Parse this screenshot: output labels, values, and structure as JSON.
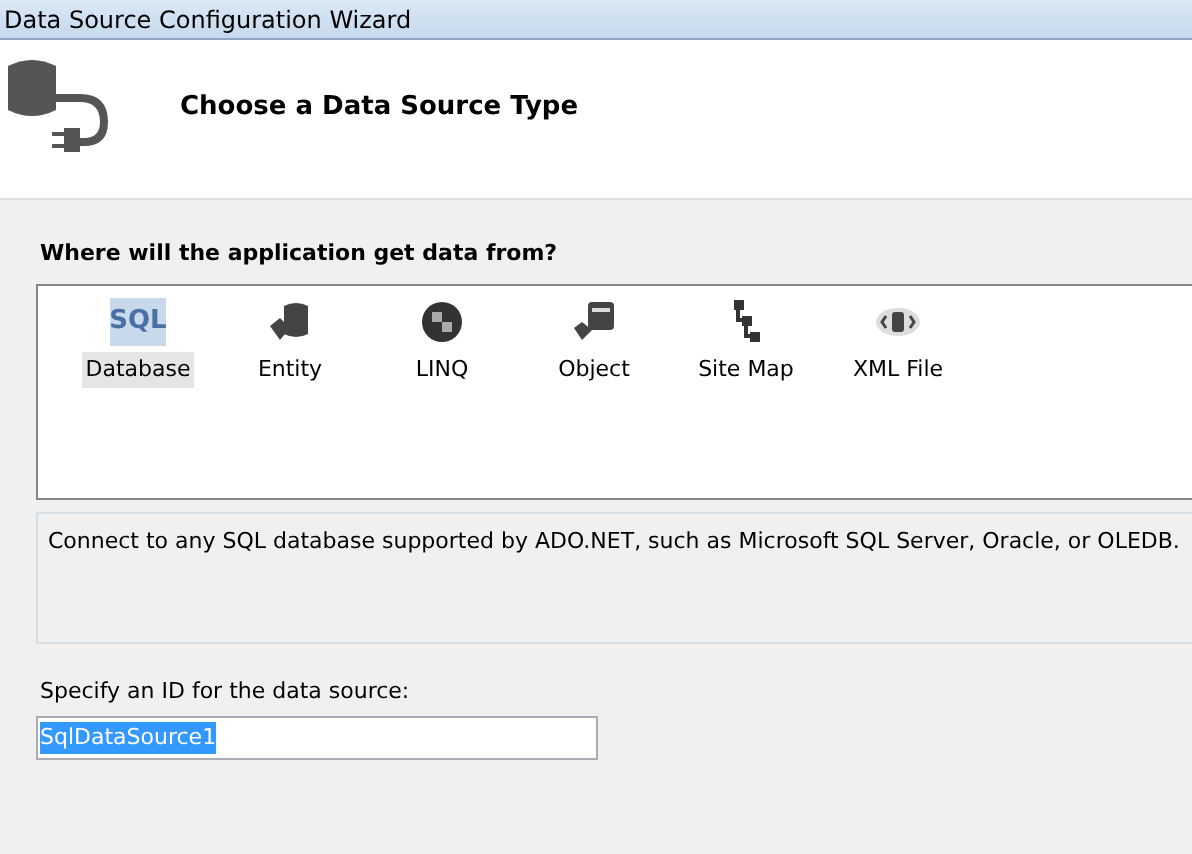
{
  "window": {
    "title": "Data Source Configuration Wizard"
  },
  "header": {
    "title": "Choose a Data Source Type"
  },
  "source_list": {
    "label": "Where will the application get data from?",
    "items": [
      {
        "label": "Database",
        "kind": "sql",
        "icon_text": "SQL",
        "selected": true
      },
      {
        "label": "Entity",
        "kind": "entity",
        "selected": false
      },
      {
        "label": "LINQ",
        "kind": "linq",
        "selected": false
      },
      {
        "label": "Object",
        "kind": "object",
        "selected": false
      },
      {
        "label": "Site Map",
        "kind": "sitemap",
        "selected": false
      },
      {
        "label": "XML File",
        "kind": "xml",
        "selected": false
      }
    ]
  },
  "description": "Connect to any SQL database supported by ADO.NET, such as Microsoft SQL Server, Oracle, or OLEDB.",
  "id_field": {
    "label": "Specify an ID for the data source:",
    "value": "SqlDataSource1",
    "value_selected": true
  }
}
